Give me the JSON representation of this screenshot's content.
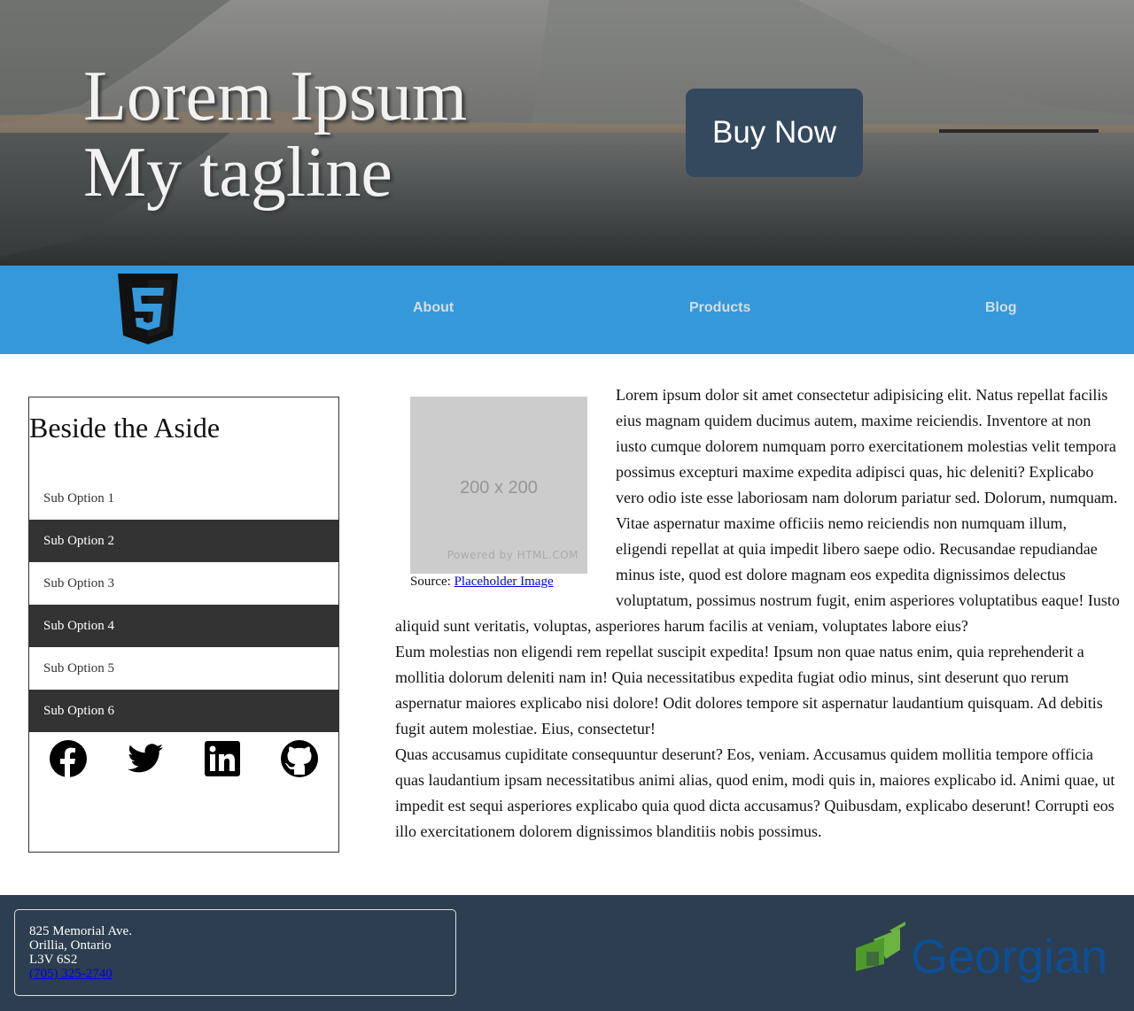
{
  "hero": {
    "title_line1": "Lorem Ipsum",
    "title_line2": "My tagline",
    "buy_label": "Buy Now"
  },
  "nav": {
    "logo_icon": "html5-logo-icon",
    "items": [
      {
        "label": "About"
      },
      {
        "label": "Products"
      },
      {
        "label": "Blog"
      }
    ]
  },
  "aside": {
    "title": "Beside the Aside",
    "options": [
      {
        "label": "Sub Option 1"
      },
      {
        "label": "Sub Option 2"
      },
      {
        "label": "Sub Option 3"
      },
      {
        "label": "Sub Option 4"
      },
      {
        "label": "Sub Option 5"
      },
      {
        "label": "Sub Option 6"
      }
    ],
    "social_icons": [
      "facebook-icon",
      "twitter-icon",
      "linkedin-icon",
      "github-icon"
    ]
  },
  "main": {
    "image_placeholder_text": "200 x 200",
    "image_powered_by": "Powered by HTML.COM",
    "caption_prefix": "Source: ",
    "caption_link": "Placeholder Image",
    "paragraphs": [
      "Lorem ipsum dolor sit amet consectetur adipisicing elit. Natus repellat facilis eius magnam quidem ducimus autem, maxime reiciendis. Inventore at non iusto cumque dolorem numquam porro exercitationem molestias velit tempora possimus excepturi maxime expedita adipisci quas, hic deleniti? Explicabo vero odio iste esse laboriosam nam dolorum pariatur sed. Dolorum, numquam.",
      "Vitae aspernatur maxime officiis nemo reiciendis non numquam illum, eligendi repellat at quia impedit libero saepe odio. Recusandae repudiandae minus iste, quod est dolore magnam eos expedita dignissimos delectus voluptatum, possimus nostrum fugit, enim asperiores voluptatibus eaque! Iusto aliquid sunt veritatis, voluptas, asperiores harum facilis at veniam, voluptates labore eius?",
      "Eum molestias non eligendi rem repellat suscipit expedita! Ipsum non quae natus enim, quia reprehenderit a mollitia dolorum deleniti nam in! Quia necessitatibus expedita fugiat odio minus, sint deserunt quo rerum aspernatur maiores explicabo nisi dolore! Odit dolores tempore sit aspernatur laudantium quisquam. Ad debitis fugit autem molestiae. Eius, consectetur!",
      "Quas accusamus cupiditate consequuntur deserunt? Eos, veniam. Accusamus quidem mollitia tempore officia quas laudantium ipsam necessitatibus animi alias, quod enim, modi quis in, maiores explicabo id. Animi quae, ut impedit est sequi asperiores explicabo quia quod dicta accusamus? Quibusdam, explicabo deserunt! Corrupti eos illo exercitationem dolorem dignissimos blanditiis nobis possimus."
    ]
  },
  "footer": {
    "address_line1": "825 Memorial Ave.",
    "address_line2": "Orillia, Ontario",
    "address_line3": "L3V 6S2",
    "phone": "(705) 325-2740",
    "logo_text": "Georgian"
  },
  "colors": {
    "nav_bg": "#3498db",
    "button_bg": "#34495e",
    "footer_bg": "#2c3e50",
    "aside_dark": "#333333"
  }
}
